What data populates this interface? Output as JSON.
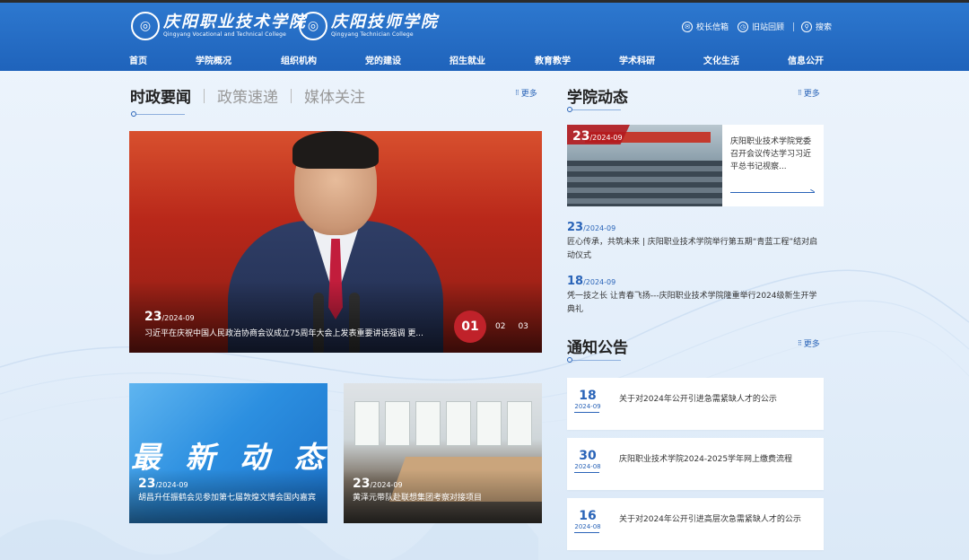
{
  "header": {
    "logo1_cn": "庆阳职业技术学院",
    "logo1_en": "Qingyang Vocational and Technical College",
    "logo2_cn": "庆阳技师学院",
    "logo2_en": "Qingyang Technician College",
    "links": [
      "校长信箱",
      "旧站回顾"
    ],
    "search_label": "搜索"
  },
  "nav": [
    "首页",
    "学院概况",
    "组织机构",
    "党的建设",
    "招生就业",
    "教育教学",
    "学术科研",
    "文化生活",
    "信息公开"
  ],
  "news": {
    "tabs": [
      "时政要闻",
      "政策速递",
      "媒体关注"
    ],
    "more": "更多",
    "hero": {
      "day": "23",
      "ym": "/2024-09",
      "caption": "习近平在庆祝中国人民政治协商会议成立75周年大会上发表重要讲话强调 更...",
      "pager_active": "01",
      "pager_others": [
        "02",
        "03"
      ]
    },
    "cards": [
      {
        "banner": "最 新 动 态",
        "day": "23",
        "ym": "/2024-09",
        "caption": "胡昌升任振鹤会见参加第七届敦煌文博会国内嘉宾"
      },
      {
        "day": "23",
        "ym": "/2024-09",
        "caption": "黄泽元带队赴联想集团考察对接项目"
      }
    ]
  },
  "dynamics": {
    "title": "学院动态",
    "more": "更多",
    "featured": {
      "day": "23",
      "ym": "/2024-09",
      "title": "庆阳职业技术学院党委召开会议传达学习习近平总书记视察..."
    },
    "items": [
      {
        "day": "23",
        "ym": "/2024-09",
        "title": "匠心传承，共筑未来 | 庆阳职业技术学院举行第五期“青蓝工程”结对启动仪式"
      },
      {
        "day": "18",
        "ym": "/2024-09",
        "title": "凭一技之长 让青春飞扬---庆阳职业技术学院隆重举行2024级新生开学典礼"
      }
    ]
  },
  "notices": {
    "title": "通知公告",
    "more": "更多",
    "items": [
      {
        "day": "18",
        "ym": "2024-09",
        "title": "关于对2024年公开引进急需紧缺人才的公示"
      },
      {
        "day": "30",
        "ym": "2024-08",
        "title": "庆阳职业技术学院2024-2025学年网上缴费流程"
      },
      {
        "day": "16",
        "ym": "2024-08",
        "title": "关于对2024年公开引进高层次急需紧缺人才的公示"
      }
    ]
  },
  "colors": {
    "primary": "#1f63bb",
    "accent_red": "#c0222a",
    "background": "#e8f1fb"
  }
}
